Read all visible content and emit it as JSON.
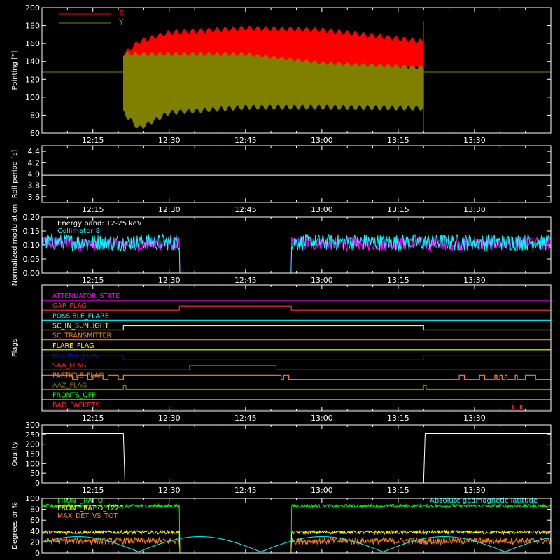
{
  "chart_data": [
    {
      "id": "pointing",
      "type": "line",
      "ylabel": "Pointing [\"]",
      "ylim": [
        60,
        200
      ],
      "yticks": [
        60,
        80,
        100,
        120,
        140,
        160,
        180,
        200
      ],
      "xlim": [
        "12:05",
        "13:45"
      ],
      "xticks": [
        "12:15",
        "12:30",
        "12:45",
        "13:00",
        "13:15",
        "13:30"
      ],
      "series": [
        {
          "name": "X",
          "color": "#ff0000",
          "baseline": 128,
          "start": "12:21",
          "end": "13:20",
          "envelope": [
            [
              "12:21",
              90,
              150
            ],
            [
              "12:24",
              72,
              165
            ],
            [
              "12:30",
              100,
              175
            ],
            [
              "12:45",
              115,
              180
            ],
            [
              "13:00",
              120,
              178
            ],
            [
              "13:20",
              130,
              165
            ]
          ],
          "spike_end": 185
        },
        {
          "name": "Y",
          "color": "#808000",
          "baseline": 128,
          "start": "12:21",
          "end": "13:20",
          "envelope": [
            [
              "12:21",
              80,
              150
            ],
            [
              "12:24",
              62,
              150
            ],
            [
              "12:30",
              80,
              150
            ],
            [
              "12:45",
              86,
              150
            ],
            [
              "13:00",
              86,
              140
            ],
            [
              "13:20",
              85,
              135
            ]
          ]
        }
      ]
    },
    {
      "id": "roll",
      "type": "line",
      "ylabel": "Roll period [s]",
      "ylim": [
        3.5,
        4.5
      ],
      "yticks": [
        "3.6",
        "3.8",
        "4.0",
        "4.2",
        "4.4"
      ],
      "xticks": [
        "12:15",
        "12:30",
        "12:45",
        "13:00",
        "13:15",
        "13:30"
      ],
      "series": [
        {
          "name": "",
          "color": "#ffffff",
          "values": [
            [
              " 12:05",
              3.98
            ],
            [
              "13:45",
              3.98
            ]
          ]
        }
      ]
    },
    {
      "id": "modulation",
      "type": "line",
      "ylabel": "Normalized modulation",
      "ylim": [
        0,
        0.2
      ],
      "yticks": [
        "0.00",
        "0.05",
        "0.10",
        "0.15",
        "0.20"
      ],
      "xticks": [
        "12:15",
        "12:30",
        "12:45",
        "13:00",
        "13:15",
        "13:30"
      ],
      "annotations": [
        "Energy band: 12-25 keV",
        "Collimator 8"
      ],
      "series": [
        {
          "name": "",
          "color": "#ff00ff",
          "level": 0.105,
          "spread": 0.025,
          "gap": [
            "12:32",
            "12:54"
          ]
        },
        {
          "name": "",
          "color": "#00ffff",
          "level": 0.11,
          "spread": 0.03,
          "gap": [
            "12:32",
            "12:54"
          ]
        }
      ]
    },
    {
      "id": "flags",
      "type": "line",
      "ylabel": "Flags",
      "xticks": [
        "12:15",
        "12:30",
        "12:45",
        "13:00",
        "13:15",
        "13:30"
      ],
      "flags": [
        {
          "name": "ATTENUATOR_STATE",
          "color": "#ff00ff",
          "steps": []
        },
        {
          "name": "GAP_FLAG",
          "color": "#ff3030",
          "steps": [
            [
              "12:32",
              "12:54"
            ]
          ]
        },
        {
          "name": "POSSIBLE_FLARE",
          "color": "#00ffff",
          "steps": []
        },
        {
          "name": "SC_IN_SUNLIGHT",
          "color": "#ffff00",
          "steps": [
            [
              "12:21",
              "13:20"
            ]
          ]
        },
        {
          "name": "SC_TRANSMITTER",
          "color": "#ff8020",
          "steps": []
        },
        {
          "name": "FLARE_FLAG",
          "color": "#ffff00",
          "steps": []
        },
        {
          "name": "ECLIPSE_FLAG",
          "color": "#0000ff",
          "steps": [
            [
              "12:05",
              "12:21"
            ],
            [
              "13:20",
              "13:45"
            ]
          ]
        },
        {
          "name": "SAA_FLAG",
          "color": "#ff2020",
          "steps": [
            [
              "12:34",
              "12:51"
            ]
          ]
        },
        {
          "name": "PARTICLE_FLAG",
          "color": "#ff8020",
          "steps": [
            [
              "12:05",
              "12:11"
            ],
            [
              "12:12",
              "12:14"
            ],
            [
              "12:15",
              "12:17"
            ],
            [
              "12:18",
              "12:20"
            ],
            [
              "12:21",
              "12:52"
            ],
            [
              "12:52.5",
              "12:53.5"
            ],
            [
              "13:27",
              "13:28"
            ],
            [
              "13:31",
              "13:32"
            ],
            [
              "13:34",
              "13:34.4"
            ],
            [
              "13:35",
              "13:35.4"
            ],
            [
              "13:36",
              "13:36.4"
            ],
            [
              "13:38",
              "13:38.4"
            ],
            [
              "13:40",
              "13:42"
            ]
          ]
        },
        {
          "name": "AAZ_FLAG",
          "color": "#808000",
          "steps": [
            [
              "12:21",
              "12:21.5"
            ],
            [
              "13:20",
              "13:20.5"
            ]
          ]
        },
        {
          "name": "FRONTS_OFF",
          "color": "#00ff00",
          "steps": []
        },
        {
          "name": "BAD_PACKETS",
          "color": "#ff2020",
          "steps": [
            [
              "13:37.5",
              "13:37.8"
            ],
            [
              "13:39",
              "13:39.3"
            ]
          ]
        }
      ]
    },
    {
      "id": "quality",
      "type": "line",
      "ylabel": "Quality",
      "ylim": [
        0,
        300
      ],
      "yticks": [
        "0",
        "50",
        "100",
        "150",
        "200",
        "250",
        "300"
      ],
      "xticks": [
        "12:15",
        "12:30",
        "12:45",
        "13:00",
        "13:15",
        "13:30"
      ],
      "series": [
        {
          "name": "",
          "color": "#ffffff",
          "values": [
            [
              "12:05",
              255
            ],
            [
              "12:21",
              255
            ],
            [
              "12:21.3",
              0
            ],
            [
              "13:20",
              0
            ],
            [
              "13:20.3",
              255
            ],
            [
              "13:45",
              255
            ]
          ]
        }
      ]
    },
    {
      "id": "degrees",
      "type": "line",
      "ylabel": "Degrees or %",
      "ylim": [
        0,
        100
      ],
      "yticks": [
        "0",
        "20",
        "40",
        "60",
        "80",
        "100"
      ],
      "series": [
        {
          "name": "FRONT_RATIO",
          "color": "#00ff00",
          "level": 86,
          "spread": 3,
          "gap": [
            "12:32",
            "12:54"
          ]
        },
        {
          "name": "FRONT_RATIO_1225",
          "color": "#ffff00",
          "level": 38,
          "spread": 3,
          "gap": [
            "12:32",
            "12:54"
          ]
        },
        {
          "name": "MAX_DET_VS_TOT",
          "color": "#ff8020",
          "level": 22,
          "spread": 6,
          "gap": [
            "12:32",
            "12:54"
          ]
        },
        {
          "name": "Absolute geomagnetic latitude",
          "color": "#00ffff"
        }
      ]
    }
  ]
}
